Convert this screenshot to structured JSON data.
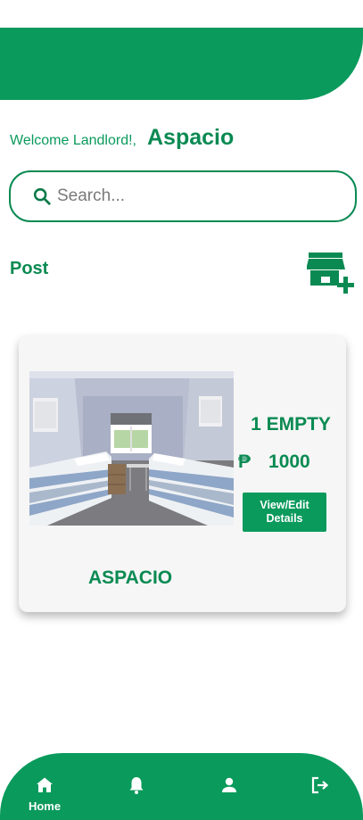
{
  "colors": {
    "brand": "#0a9a5c",
    "brand_dark": "#0a8a52",
    "card": "#f6f6f6"
  },
  "header": {
    "welcome": "Welcome Landlord!,",
    "user_name": "Aspacio"
  },
  "search": {
    "placeholder": "Search...",
    "value": ""
  },
  "section": {
    "post_label": "Post",
    "add_icon": "add-business-icon"
  },
  "listing": {
    "status": "1 EMPTY",
    "currency_symbol": "₱",
    "price": "1000",
    "button_label": "View/Edit Details",
    "name": "ASPACIO",
    "photo": "dorm-room-photo"
  },
  "nav": {
    "items": [
      {
        "icon": "home-icon",
        "label": "Home",
        "active": true
      },
      {
        "icon": "bell-icon",
        "label": ""
      },
      {
        "icon": "person-icon",
        "label": ""
      },
      {
        "icon": "logout-icon",
        "label": ""
      }
    ]
  }
}
